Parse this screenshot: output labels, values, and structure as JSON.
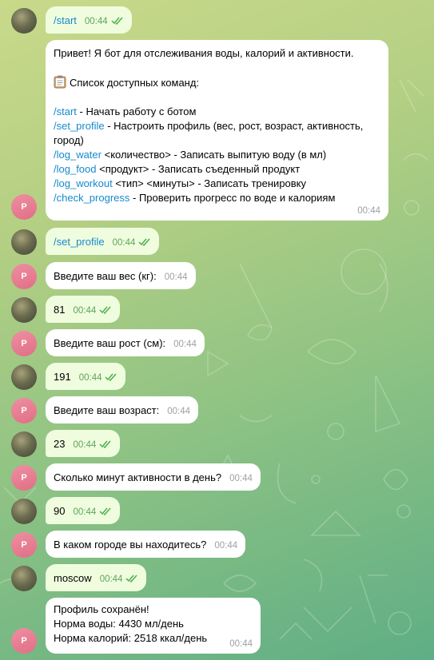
{
  "colors": {
    "bg_top": "#c9d98a",
    "bg_bottom": "#5fae85",
    "outgoing_bubble": "#effdde",
    "incoming_bubble": "#ffffff",
    "command_link": "#168acd",
    "bot_avatar": "#e06f86",
    "read_check": "#4fae4e"
  },
  "bot_avatar_letter": "P",
  "messages": {
    "m1": {
      "text": "/start",
      "time": "00:44"
    },
    "m2": {
      "greeting": "Привет! Я бот для отслеживания воды, калорий и активности.",
      "list_icon": "clipboard-icon",
      "list_title": "Список доступных команд:",
      "commands": [
        {
          "cmd": "/start",
          "desc": " - Начать работу с ботом"
        },
        {
          "cmd": "/set_profile",
          "desc": " - Настроить профиль (вес, рост, возраст, активность, город)"
        },
        {
          "cmd": "/log_water",
          "desc": " <количество> - Записать выпитую воду (в мл)"
        },
        {
          "cmd": "/log_food",
          "desc": " <продукт> - Записать съеденный продукт"
        },
        {
          "cmd": "/log_workout",
          "desc": " <тип> <минуты> - Записать тренировку"
        },
        {
          "cmd": "/check_progress",
          "desc": " - Проверить прогресс по воде и калориям"
        }
      ],
      "time": "00:44"
    },
    "m3": {
      "text": "/set_profile",
      "time": "00:44"
    },
    "m4": {
      "text": "Введите ваш вес (кг):",
      "time": "00:44"
    },
    "m5": {
      "text": "81",
      "time": "00:44"
    },
    "m6": {
      "text": "Введите ваш рост (см):",
      "time": "00:44"
    },
    "m7": {
      "text": "191",
      "time": "00:44"
    },
    "m8": {
      "text": "Введите ваш возраст:",
      "time": "00:44"
    },
    "m9": {
      "text": "23",
      "time": "00:44"
    },
    "m10": {
      "text": "Сколько минут активности в день?",
      "time": "00:44"
    },
    "m11": {
      "text": "90",
      "time": "00:44"
    },
    "m12": {
      "text": "В каком городе вы находитесь?",
      "time": "00:44"
    },
    "m13": {
      "text": "moscow",
      "time": "00:44"
    },
    "m14": {
      "line1": "Профиль сохранён!",
      "line2": "Норма воды: 4430 мл/день",
      "line3": "Норма калорий: 2518 ккал/день",
      "time": "00:44"
    }
  }
}
